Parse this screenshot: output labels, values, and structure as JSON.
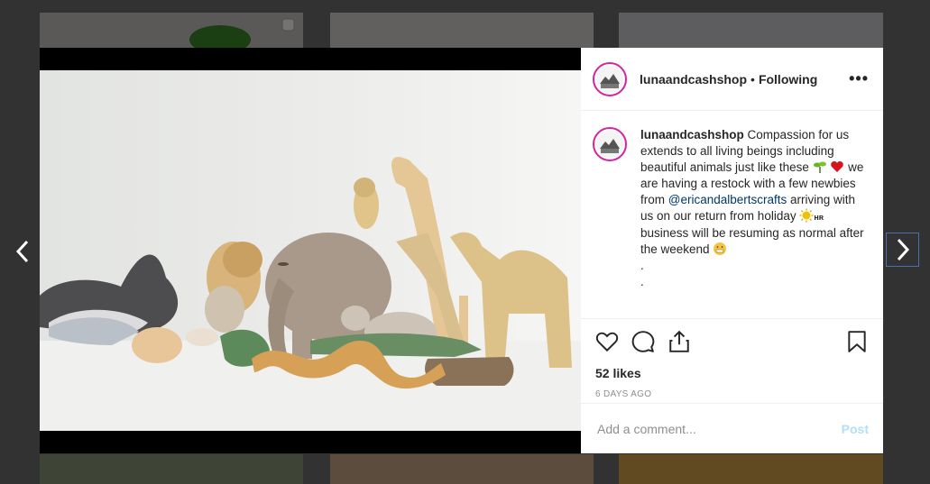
{
  "post": {
    "username": "lunaandcashshop",
    "separator": "•",
    "follow_status": "Following",
    "more_label": "•••",
    "caption": {
      "username": "lunaandcashshop",
      "line1": "Compassion for us extends to all living beings including beautiful animals just like these",
      "line2": "we are having a restock with a few newbies from",
      "mention": "@ericandalbertscrafts",
      "line3": "arriving with us on our return from holiday",
      "line4": "business will be resuming as normal after the weekend",
      "dot1": ".",
      "dot2": "."
    },
    "likes": "52 likes",
    "timestamp": "6 DAYS AGO"
  },
  "comment": {
    "placeholder": "Add a comment...",
    "post_label": "Post"
  },
  "icons": {
    "like": "heart-icon",
    "comment": "comment-icon",
    "share": "share-icon",
    "save": "bookmark-icon",
    "prev": "chevron-left-icon",
    "next": "chevron-right-icon"
  },
  "colors": {
    "story_ring": "#d6249f",
    "mention": "#00376b",
    "post_button": "#b2dffc"
  }
}
